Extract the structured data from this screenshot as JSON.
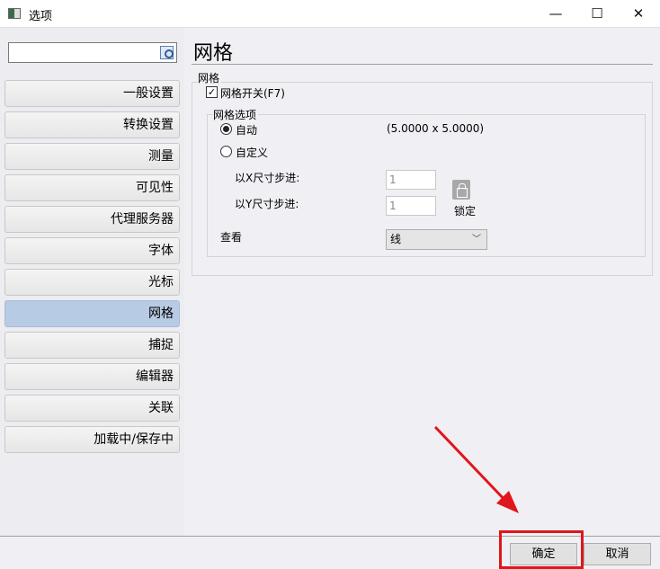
{
  "window": {
    "title": "选项",
    "minimize": "—",
    "maximize": "☐",
    "close": "✕"
  },
  "search": {
    "value": "",
    "placeholder": ""
  },
  "sidebar": {
    "items": [
      {
        "label": "一般设置"
      },
      {
        "label": "转换设置"
      },
      {
        "label": "测量"
      },
      {
        "label": "可见性"
      },
      {
        "label": "代理服务器"
      },
      {
        "label": "字体"
      },
      {
        "label": "光标"
      },
      {
        "label": "网格",
        "selected": true
      },
      {
        "label": "捕捉"
      },
      {
        "label": "编辑器"
      },
      {
        "label": "关联"
      },
      {
        "label": "加载中/保存中"
      }
    ]
  },
  "main": {
    "heading": "网格",
    "grid_group": "网格",
    "grid_toggle": {
      "label": "网格开关(F7)",
      "checked": true
    },
    "options_group": "网格选项",
    "auto": {
      "label": "自动",
      "selected": true,
      "value": "(5.0000 x 5.0000)"
    },
    "custom": {
      "label": "自定义",
      "selected": false
    },
    "x_step": {
      "label": "以X尺寸步进:",
      "value": "1"
    },
    "y_step": {
      "label": "以Y尺寸步进:",
      "value": "1"
    },
    "lock_label": "锁定",
    "view": {
      "label": "查看",
      "value": "线"
    }
  },
  "footer": {
    "ok": "确定",
    "cancel": "取消"
  },
  "colors": {
    "selected": "#b8cbe4",
    "annotation": "#e0161b"
  }
}
